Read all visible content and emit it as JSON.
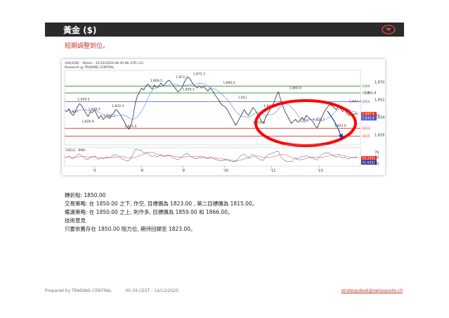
{
  "header": {
    "title": "黃金 ($)",
    "icon": "chevron-down-circle-icon",
    "accent": "#e74c3c"
  },
  "subtitle": "短期調整到位。",
  "chart_data": {
    "type": "line",
    "title": "XAU/USD - 30min - 12/14/2020 04:45:06 (UTC+2)",
    "subtitle": "Research @ TRADING CENTRAL",
    "x_ticks": [
      "'5",
      "'8",
      "'9",
      "'10",
      "'11",
      "'13"
    ],
    "y_ticks": [
      "1,870",
      "1,852",
      "1,834",
      "1,816"
    ],
    "ylim": [
      1806,
      1882
    ],
    "levels": [
      {
        "value": 1866,
        "label": "1866",
        "color": "#2e8b2e"
      },
      {
        "value": 1859,
        "label": "1859",
        "color": "#2e8b2e"
      },
      {
        "value": 1850,
        "label": "1850",
        "color": "#3b5bdb"
      },
      {
        "value": 1823,
        "label": "1823",
        "color": "#e03131"
      },
      {
        "value": 1815,
        "label": "1815",
        "color": "#e03131"
      }
    ],
    "current_price": [
      {
        "label": "1,837.4",
        "color": "#e03131"
      },
      {
        "label": "1,835.8",
        "color": "#3b5bdb"
      }
    ],
    "annotations": [
      {
        "label": "1,849.2",
        "x": 8,
        "y": 1849.2
      },
      {
        "label": "1,839.4",
        "x": 13,
        "y": 1839.4
      },
      {
        "label": "1,842.4",
        "x": 24,
        "y": 1842.4
      },
      {
        "label": "1,868.5",
        "x": 42,
        "y": 1868.5
      },
      {
        "label": "1,872.1",
        "x": 54,
        "y": 1872.1
      },
      {
        "label": "1,875.3",
        "x": 62,
        "y": 1875.3
      },
      {
        "label": "1,866.2",
        "x": 76,
        "y": 1866.2
      },
      {
        "label": "1,859.3",
        "x": 57,
        "y": 1859.3
      },
      {
        "label": "1,837",
        "x": 4,
        "y": 1837
      },
      {
        "label": "1,826.9",
        "x": 10,
        "y": 1826.9
      },
      {
        "label": "1,832.7",
        "x": 20,
        "y": 1832.7
      },
      {
        "label": "1,821.6",
        "x": 30,
        "y": 1821.6
      },
      {
        "label": "1,851",
        "x": 83,
        "y": 1851
      },
      {
        "label": "1,842.6",
        "x": 95,
        "y": 1842.6
      },
      {
        "label": "1,825.8",
        "x": 90,
        "y": 1825.8
      },
      {
        "label": "1,860.8",
        "x": 107,
        "y": 1860.8
      },
      {
        "label": "1,827",
        "x": 112,
        "y": 1827
      },
      {
        "label": "1,829.1",
        "x": 118,
        "y": 1829.1
      },
      {
        "label": "1,847.4",
        "x": 135,
        "y": 1847.4
      },
      {
        "label": "1,855.8",
        "x": 142,
        "y": 1855.8
      },
      {
        "label": "1,822.6",
        "x": 128,
        "y": 1822.6
      },
      {
        "label": "1,833",
        "x": 145,
        "y": 1833
      }
    ],
    "series": [
      {
        "values": [
          1841,
          1840,
          1843,
          1838,
          1836,
          1840,
          1845,
          1848,
          1846,
          1842,
          1838,
          1835,
          1840,
          1839,
          1842,
          1837,
          1833,
          1836,
          1832,
          1834,
          1835,
          1833,
          1836,
          1839,
          1842,
          1840,
          1837,
          1833,
          1829,
          1825,
          1822,
          1826,
          1835,
          1848,
          1856,
          1860,
          1864,
          1862,
          1866,
          1868,
          1865,
          1863,
          1867,
          1864,
          1866,
          1869,
          1866,
          1868,
          1871,
          1872,
          1869,
          1866,
          1863,
          1860,
          1862,
          1865,
          1870,
          1874,
          1875,
          1872,
          1868,
          1866,
          1864,
          1866,
          1864,
          1866,
          1863,
          1861,
          1864,
          1862,
          1858,
          1855,
          1852,
          1848,
          1846,
          1845,
          1842,
          1838,
          1834,
          1830,
          1826,
          1830,
          1834,
          1838,
          1842,
          1838,
          1836,
          1840,
          1844,
          1842,
          1838,
          1835,
          1830,
          1828,
          1834,
          1838,
          1842,
          1846,
          1850,
          1856,
          1860,
          1852,
          1846,
          1840,
          1836,
          1832,
          1828,
          1830,
          1832,
          1829,
          1831,
          1834,
          1832,
          1836,
          1834,
          1832,
          1830,
          1826,
          1823,
          1828,
          1833,
          1838,
          1842,
          1845,
          1847,
          1846,
          1844,
          1842,
          1845,
          1843,
          1840,
          1842,
          1838,
          1836,
          1838,
          1837,
          1838,
          1837
        ]
      }
    ],
    "indicator": {
      "label": "RSI14 - 9MA",
      "ticks": [
        "70",
        "50",
        "30"
      ],
      "value_labels": [
        "50.2451",
        "45.6091"
      ]
    }
  },
  "analysis": {
    "pivot": "轉折點:  1850.00",
    "strategy": "交易策略:  在 1850.00 之下,  作空,  目標價為 1823.00 ,  第二目標價為 1815.00。",
    "alternative": "備選策略:  在 1850.00 之上,  則作多,  目標價為 1859.00 和 1866.00。",
    "comment_title": "技術意見",
    "comment": "只要依舊存在 1850.00 阻力位,  期待回歸至 1823.00。"
  },
  "footer": {
    "prepared_by": "Prepared by TRADING CENTRAL",
    "timestamp": "05:39 CEST - 14/12/2020",
    "email": "strategydesk@swissquote.ch"
  }
}
